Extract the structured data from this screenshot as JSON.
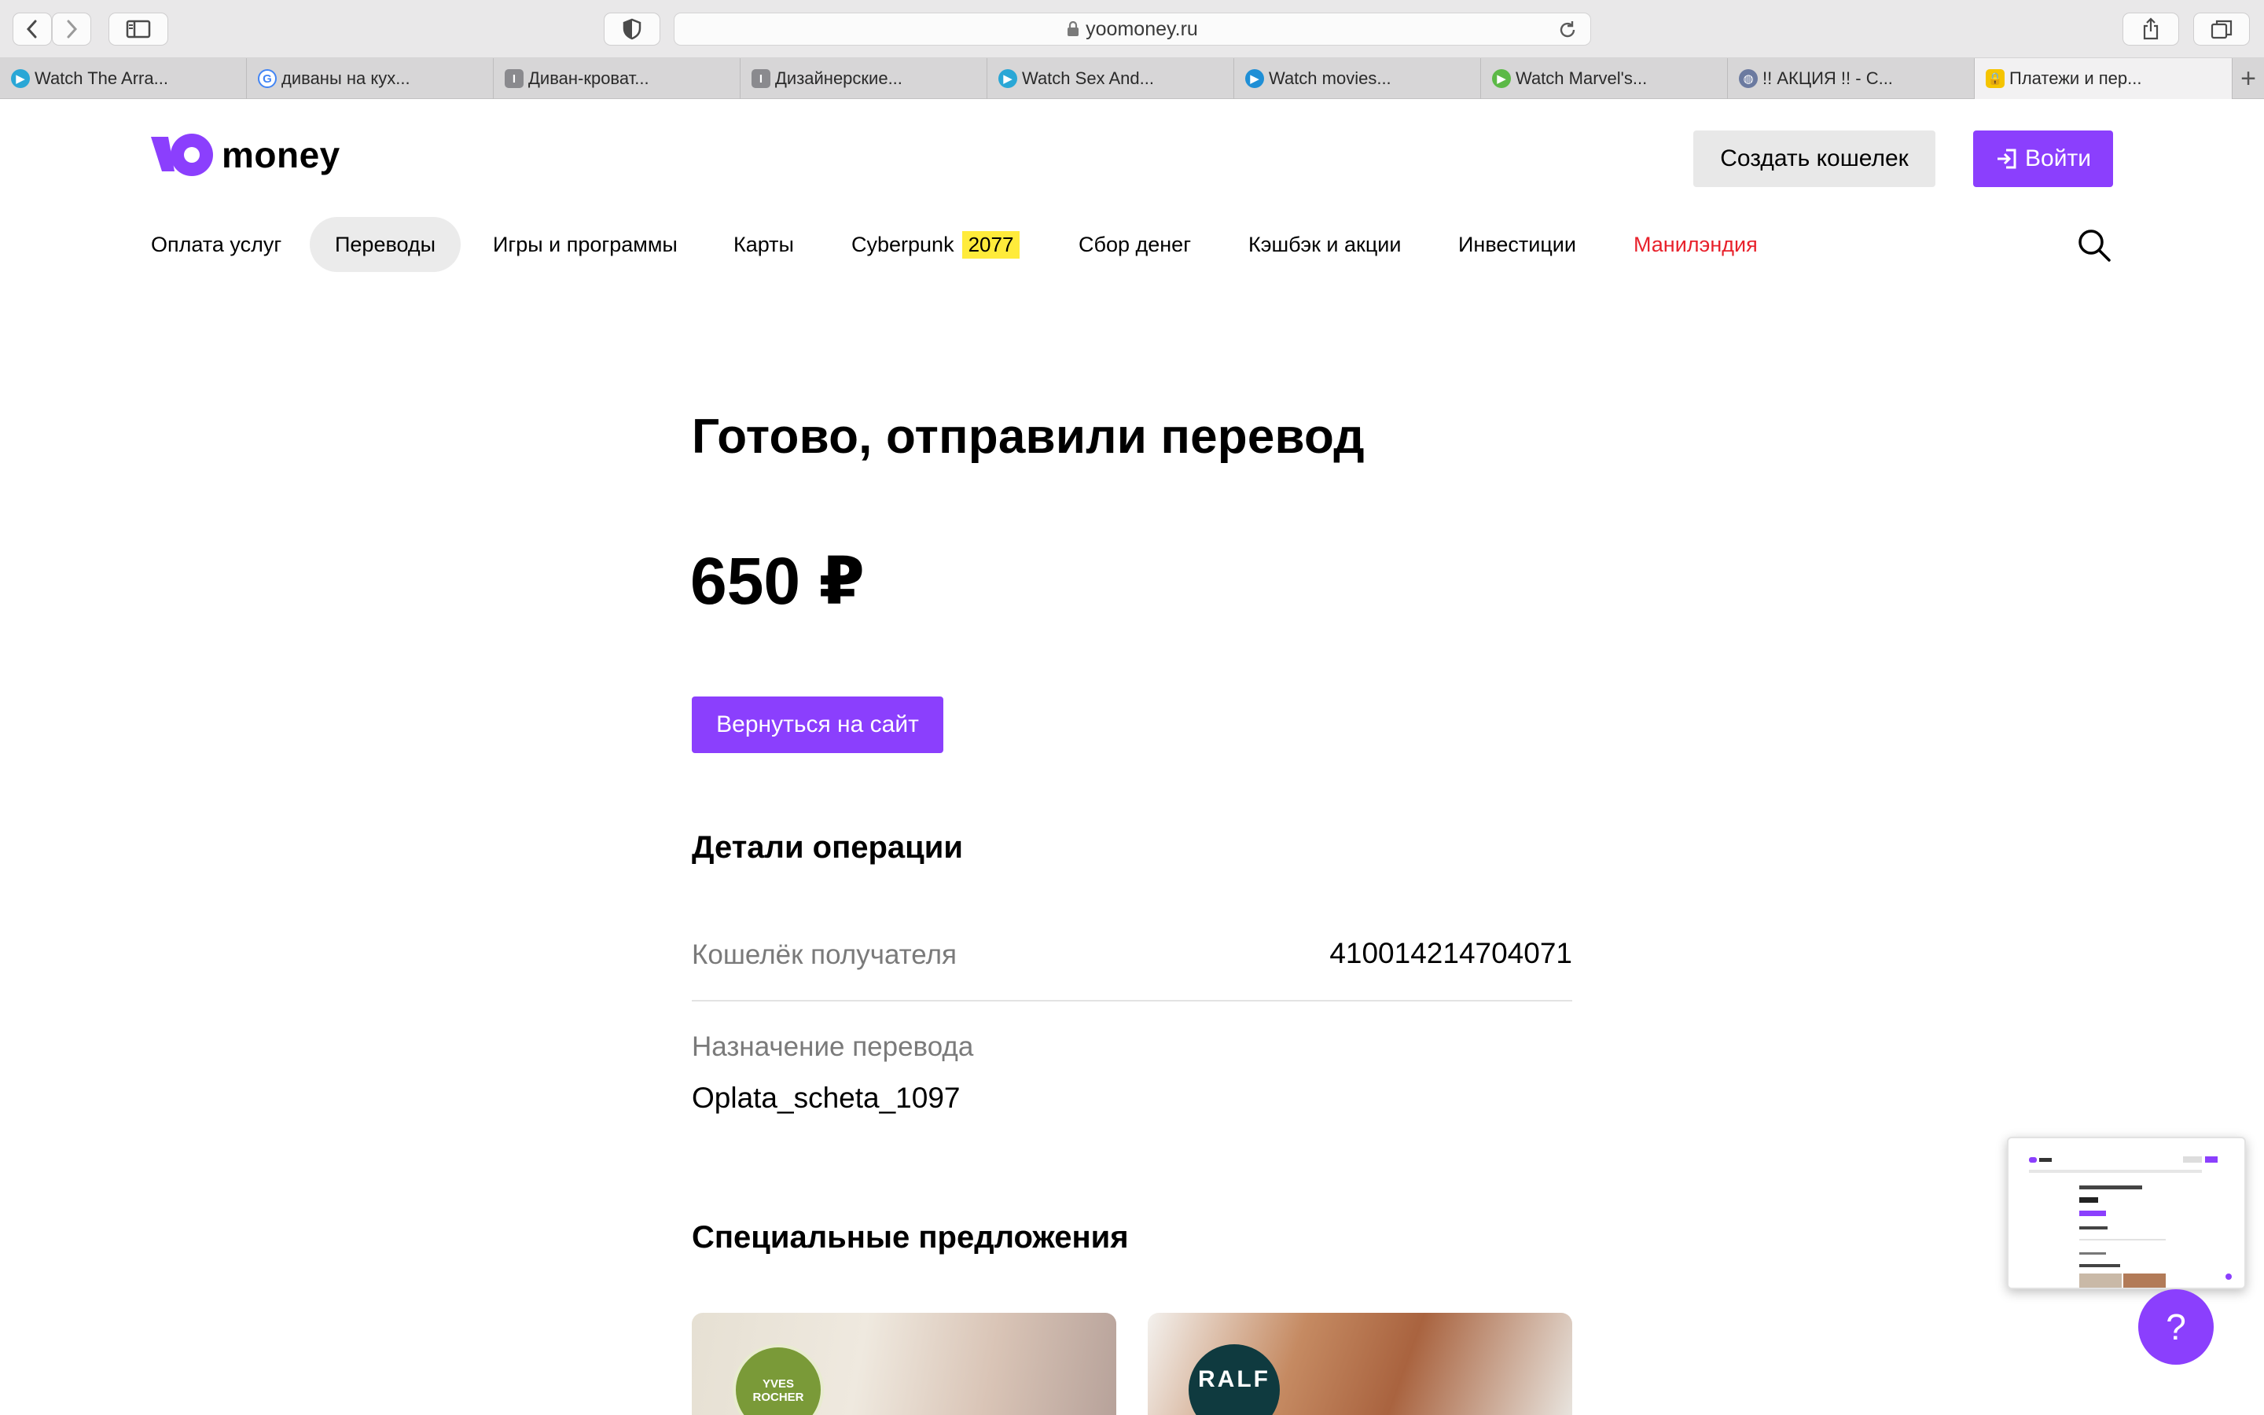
{
  "browser": {
    "url": "yoomoney.ru",
    "tabs": [
      {
        "title": "Watch The Arra...",
        "icon": "play-icon",
        "color": "#2aa7d6"
      },
      {
        "title": "диваны на кух...",
        "icon": "google-icon",
        "color": "#4285f4"
      },
      {
        "title": "Диван-кроват...",
        "icon": "site-icon",
        "color": "#8a8a8e"
      },
      {
        "title": "Дизайнерские...",
        "icon": "site-icon",
        "color": "#8a8a8e"
      },
      {
        "title": "Watch Sex And...",
        "icon": "play-icon",
        "color": "#2aa7d6"
      },
      {
        "title": "Watch movies...",
        "icon": "play-icon",
        "color": "#1f8fd6"
      },
      {
        "title": "Watch Marvel's...",
        "icon": "play-icon",
        "color": "#5cb947"
      },
      {
        "title": "!! АКЦИЯ !! - С...",
        "icon": "globe-icon",
        "color": "#6b7aa0"
      },
      {
        "title": "Платежи и пер...",
        "icon": "lock-icon",
        "color": "#f5c400"
      }
    ]
  },
  "header": {
    "logo_text": "money",
    "create_wallet": "Создать кошелек",
    "login": "Войти"
  },
  "nav": {
    "items": [
      {
        "label": "Оплата услуг"
      },
      {
        "label": "Переводы",
        "active": true
      },
      {
        "label": "Игры и программы"
      },
      {
        "label": "Карты"
      },
      {
        "label": "Cyberpunk",
        "badge": "2077"
      },
      {
        "label": "Сбор денег"
      },
      {
        "label": "Кэшбэк и акции"
      },
      {
        "label": "Инвестиции"
      },
      {
        "label": "Манилэндия"
      }
    ]
  },
  "main": {
    "title": "Готово, отправили перевод",
    "amount": "650 ₽",
    "back_button": "Вернуться на сайт",
    "details_heading": "Детали операции",
    "recipient_label": "Кошелёк получателя",
    "recipient_value": "410014214704071",
    "purpose_label": "Назначение перевода",
    "purpose_value": "Oplata_scheta_1097",
    "offers_heading": "Специальные предложения",
    "offers": [
      {
        "brand": "YVES ROCHER"
      },
      {
        "brand": "RALF"
      }
    ]
  },
  "help": {
    "label": "?"
  },
  "colors": {
    "accent": "#8b3ffd",
    "highlight": "#ffeb3b",
    "alert_link": "#e8212b"
  }
}
